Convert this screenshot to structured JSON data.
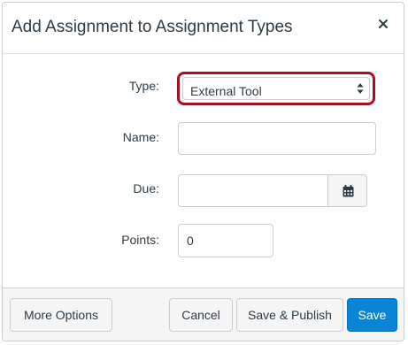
{
  "dialog": {
    "title": "Add Assignment to Assignment Types"
  },
  "form": {
    "type_label": "Type:",
    "type_value": "External Tool",
    "name_label": "Name:",
    "name_value": "",
    "due_label": "Due:",
    "due_value": "",
    "points_label": "Points:",
    "points_value": "0"
  },
  "footer": {
    "more_options_label": "More Options",
    "cancel_label": "Cancel",
    "save_publish_label": "Save & Publish",
    "save_label": "Save"
  },
  "colors": {
    "highlight": "#a50e23",
    "primary": "#0a84d7",
    "text": "#2d3b45"
  },
  "icons": {
    "close": "close-icon",
    "select_arrows": "select-arrows-icon",
    "calendar": "calendar-icon"
  }
}
